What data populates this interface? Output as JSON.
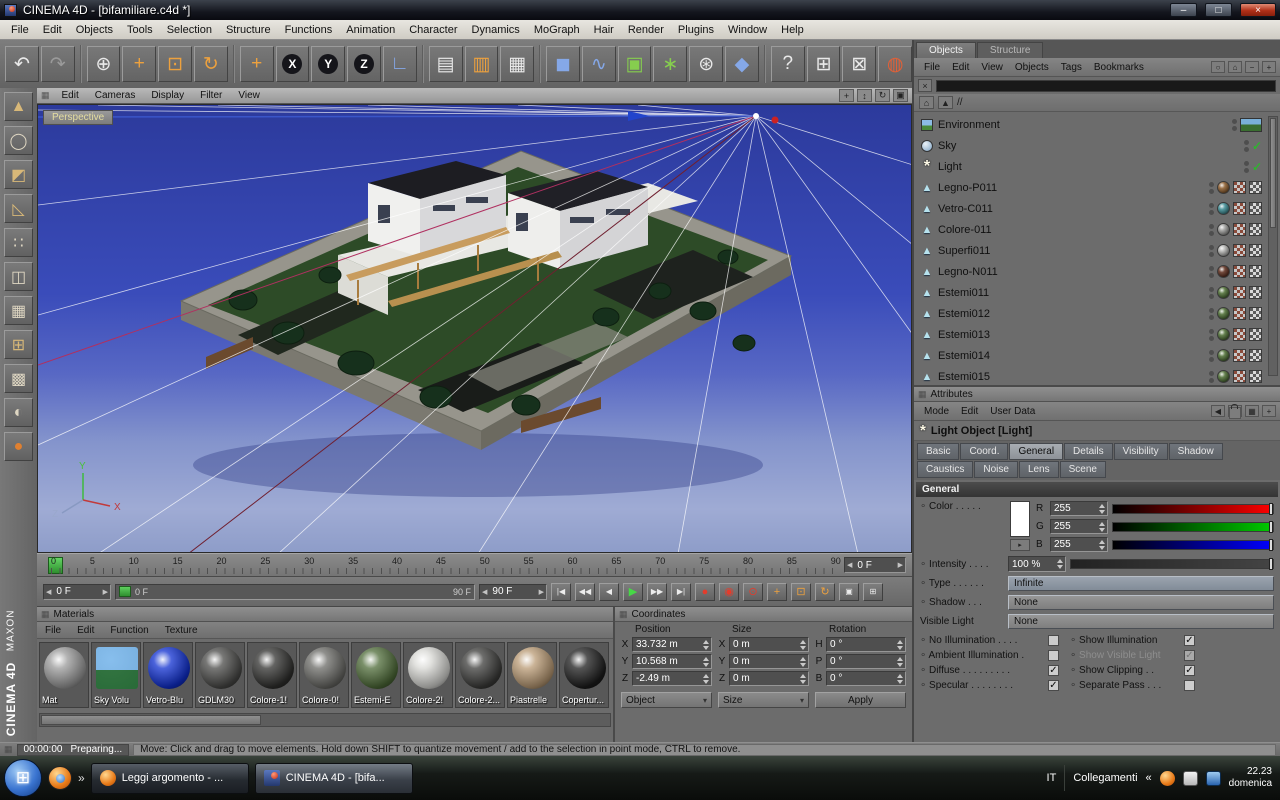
{
  "titlebar": {
    "title": "CINEMA 4D - [bifamiliare.c4d *]",
    "minimize": "–",
    "maximize": "□",
    "close": "×"
  },
  "menubar": {
    "items": [
      "File",
      "Edit",
      "Objects",
      "Tools",
      "Selection",
      "Structure",
      "Functions",
      "Animation",
      "Character",
      "Dynamics",
      "MoGraph",
      "Hair",
      "Render",
      "Plugins",
      "Window",
      "Help"
    ]
  },
  "toolbar": {
    "icons": [
      {
        "name": "undo",
        "glyph": "↶"
      },
      {
        "name": "redo",
        "glyph": "↷"
      },
      {
        "name": "live-selection",
        "glyph": "⊕"
      },
      {
        "name": "move",
        "glyph": "+"
      },
      {
        "name": "scale",
        "glyph": "⊡"
      },
      {
        "name": "rotate",
        "glyph": "↻"
      },
      {
        "name": "active-tool-move",
        "glyph": "+"
      },
      {
        "name": "lock-x",
        "glyph": "X"
      },
      {
        "name": "lock-y",
        "glyph": "Y"
      },
      {
        "name": "lock-z",
        "glyph": "Z"
      },
      {
        "name": "coordinate-system",
        "glyph": "∟"
      },
      {
        "name": "render-view",
        "glyph": "▤"
      },
      {
        "name": "render-active-view",
        "glyph": "▥"
      },
      {
        "name": "render-settings",
        "glyph": "▦"
      },
      {
        "name": "add-cube",
        "glyph": "◼"
      },
      {
        "name": "add-spline",
        "glyph": "∿"
      },
      {
        "name": "add-array",
        "glyph": "▣"
      },
      {
        "name": "add-symmetry",
        "glyph": "∗"
      },
      {
        "name": "add-particle",
        "glyph": "⊛"
      },
      {
        "name": "add-deformer",
        "glyph": "◆"
      },
      {
        "name": "help",
        "glyph": "?"
      },
      {
        "name": "xpresso",
        "glyph": "⊞"
      },
      {
        "name": "content-browser",
        "glyph": "⊠"
      },
      {
        "name": "online-help-globe",
        "glyph": "◍"
      }
    ]
  },
  "left_toolbar": {
    "icons": [
      {
        "name": "make-editable",
        "glyph": "▲"
      },
      {
        "name": "model-mode",
        "glyph": "◯"
      },
      {
        "name": "texture-mode",
        "glyph": "◩"
      },
      {
        "name": "workplane-mode",
        "glyph": "◺"
      },
      {
        "name": "points-mode",
        "glyph": "∷"
      },
      {
        "name": "edges-mode",
        "glyph": "◫"
      },
      {
        "name": "polygons-mode",
        "glyph": "▦"
      },
      {
        "name": "object-axis-mode",
        "glyph": "⊞"
      },
      {
        "name": "texture-axis-mode",
        "glyph": "▩"
      },
      {
        "name": "animation-mode",
        "glyph": "◐"
      },
      {
        "name": "kinematics-mode",
        "glyph": "●"
      }
    ]
  },
  "branding": {
    "line1": "MAXON",
    "line2": "CINEMA 4D"
  },
  "viewport": {
    "menu": [
      "Edit",
      "Cameras",
      "Display",
      "Filter",
      "View"
    ],
    "label": "Perspective",
    "nav": [
      {
        "name": "pan-view",
        "glyph": "+"
      },
      {
        "name": "zoom-view",
        "glyph": "↕"
      },
      {
        "name": "rotate-view",
        "glyph": "↻"
      },
      {
        "name": "toggle-view",
        "glyph": "▣"
      }
    ],
    "axis": {
      "x": "X",
      "y": "Y",
      "z": "Z"
    }
  },
  "timeline": {
    "ticks": [
      "0",
      "5",
      "10",
      "15",
      "20",
      "25",
      "30",
      "35",
      "40",
      "45",
      "50",
      "55",
      "60",
      "65",
      "70",
      "75",
      "80",
      "85",
      "90"
    ],
    "frame_field": "0 F"
  },
  "transport": {
    "current": "0 F",
    "range_start": "0 F",
    "range_end": "90 F",
    "end": "90 F",
    "buttons": [
      {
        "name": "goto-start",
        "glyph": "|◀"
      },
      {
        "name": "prev-key",
        "glyph": "◀◀"
      },
      {
        "name": "prev-frame",
        "glyph": "◀"
      },
      {
        "name": "play",
        "glyph": "▶"
      },
      {
        "name": "next-key",
        "glyph": "▶▶"
      },
      {
        "name": "goto-end",
        "glyph": "▶|"
      }
    ],
    "record": [
      {
        "name": "record-keyframe",
        "glyph": "●"
      },
      {
        "name": "autokeying",
        "glyph": "◉"
      },
      {
        "name": "record-options",
        "glyph": "⊙"
      },
      {
        "name": "record-position",
        "glyph": "+"
      },
      {
        "name": "record-scale",
        "glyph": "⊡"
      },
      {
        "name": "record-rotation",
        "glyph": "↻"
      },
      {
        "name": "record-parameter",
        "glyph": "▣"
      },
      {
        "name": "record-pla",
        "glyph": "⊞"
      }
    ]
  },
  "materials": {
    "title": "Materials",
    "menu": [
      "File",
      "Edit",
      "Function",
      "Texture"
    ],
    "items": [
      {
        "name": "Mat",
        "color": "#9a9a9a"
      },
      {
        "name": "Sky Volu",
        "color": "#4a7fb5"
      },
      {
        "name": "Vetro-Blu",
        "color": "#0f2fd0"
      },
      {
        "name": "GDLM30",
        "color": "#4a4a48"
      },
      {
        "name": "Colore-1!",
        "color": "#30302e"
      },
      {
        "name": "Colore-0!",
        "color": "#6a6a66"
      },
      {
        "name": "Estemi-E",
        "color": "#4e6b38"
      },
      {
        "name": "Colore-2!",
        "color": "#d8d8d4"
      },
      {
        "name": "Colore-2...",
        "color": "#3c3c3a"
      },
      {
        "name": "Piastrelle",
        "color": "#b99a74"
      },
      {
        "name": "Copertur...",
        "color": "#1c1c1c"
      }
    ]
  },
  "coordinates": {
    "title": "Coordinates",
    "columns": [
      "Position",
      "Size",
      "Rotation"
    ],
    "rows": [
      {
        "pos_axis": "X",
        "pos": "33.732 m",
        "size_axis": "X",
        "size": "0 m",
        "rot_axis": "H",
        "rot": "0 °"
      },
      {
        "pos_axis": "Y",
        "pos": "10.568 m",
        "size_axis": "Y",
        "size": "0 m",
        "rot_axis": "P",
        "rot": "0 °"
      },
      {
        "pos_axis": "Z",
        "pos": "-2.49 m",
        "size_axis": "Z",
        "size": "0 m",
        "rot_axis": "B",
        "rot": "0 °"
      }
    ],
    "object_dropdown": "Object",
    "size_dropdown": "Size",
    "apply_label": "Apply"
  },
  "object_manager": {
    "tabs": [
      "Objects",
      "Structure"
    ],
    "menu": [
      "File",
      "Edit",
      "View",
      "Objects",
      "Tags",
      "Bookmarks"
    ],
    "path": "//",
    "items": [
      {
        "name": "Environment"
      },
      {
        "name": "Sky",
        "mark": "✓"
      },
      {
        "name": "Light",
        "mark": "✓"
      },
      {
        "name": "Legno-P011",
        "tag_color": "#8a5a2a"
      },
      {
        "name": "Vetro-C011",
        "tag_color": "#3a8a92"
      },
      {
        "name": "Colore-011",
        "tag_color": "#9a9a98"
      },
      {
        "name": "Superfi011",
        "tag_color": "#b0b0ae"
      },
      {
        "name": "Legno-N011",
        "tag_color": "#5a2a1a"
      },
      {
        "name": "Estemi011",
        "tag_color": "#4a6b30"
      },
      {
        "name": "Estemi012",
        "tag_color": "#4a6b30"
      },
      {
        "name": "Estemi013",
        "tag_color": "#4a6b30"
      },
      {
        "name": "Estemi014",
        "tag_color": "#4a6b30"
      },
      {
        "name": "Estemi015",
        "tag_color": "#4a6b30"
      }
    ]
  },
  "attributes": {
    "title": "Attributes",
    "menu": [
      "Mode",
      "Edit",
      "User Data"
    ],
    "object_title": "Light Object [Light]",
    "tabs_row1": [
      "Basic",
      "Coord.",
      "General",
      "Details",
      "Visibility",
      "Shadow",
      "Caustics"
    ],
    "tabs_row2": [
      "Noise",
      "Lens",
      "Scene"
    ],
    "active_tab": "General",
    "section": "General",
    "props": {
      "color_label": "Color . . . . .",
      "r_label": "R",
      "r": "255",
      "g_label": "G",
      "g": "255",
      "b_label": "B",
      "b": "255",
      "intensity_label": "Intensity . . . .",
      "intensity": "100 %",
      "type_label": "Type . . . . . .",
      "type": "Infinite",
      "shadow_label": "Shadow . . .",
      "shadow": "None",
      "visible_label": "Visible Light",
      "visible": "None"
    },
    "checks": [
      {
        "label": "No Illumination . . . .",
        "mark": ""
      },
      {
        "label": "Show Illumination",
        "mark": "✓"
      },
      {
        "label": "Ambient Illumination .",
        "mark": ""
      },
      {
        "label": "Show Visible Light",
        "mark": "✓"
      },
      {
        "label": "Diffuse . . . . . . . . .",
        "mark": "✓"
      },
      {
        "label": "Show Clipping . .",
        "mark": "✓"
      },
      {
        "label": "Specular . . . . . . . .",
        "mark": "✓"
      },
      {
        "label": "Separate Pass . . .",
        "mark": ""
      }
    ]
  },
  "statusbar": {
    "time": "00:00:00",
    "status": "Preparing...",
    "message": "Move: Click and drag to move elements. Hold down SHIFT to quantize movement / add to the selection in point mode, CTRL to remove."
  },
  "taskbar": {
    "apps": [
      {
        "label": "Leggi argomento - ..."
      },
      {
        "label": "CINEMA 4D - [bifa..."
      }
    ],
    "tray": {
      "lang": "IT",
      "links_label": "Collegamenti",
      "chevron": "«",
      "time": "22.23",
      "date": "domenica"
    }
  }
}
